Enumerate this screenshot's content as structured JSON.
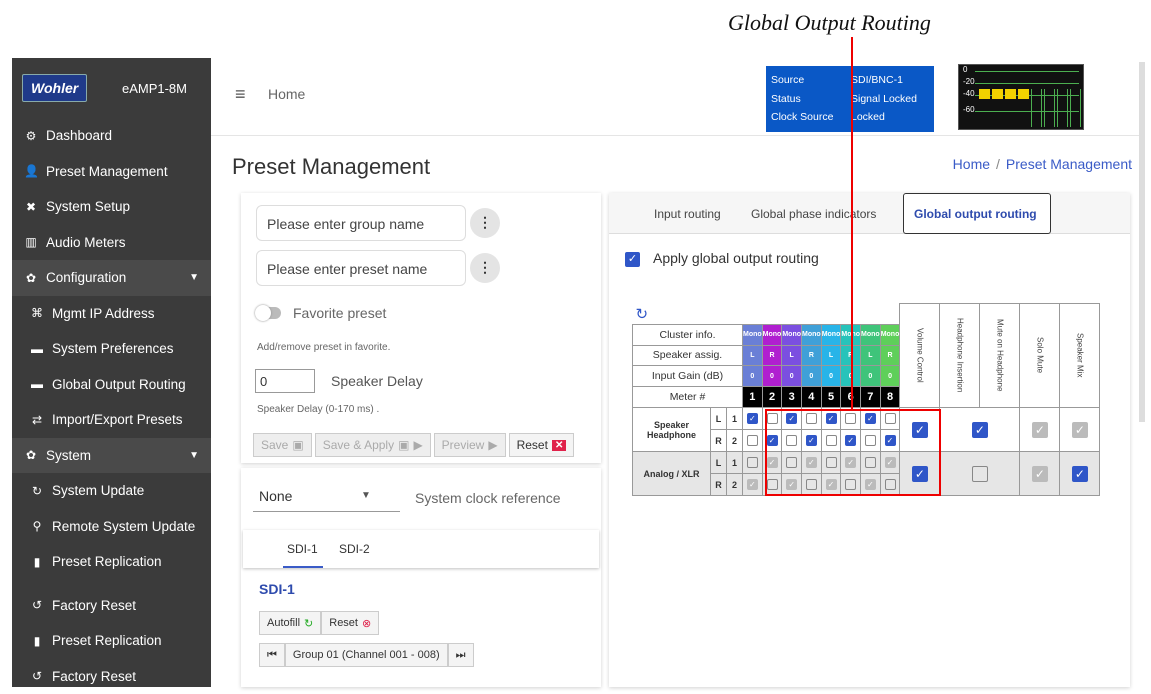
{
  "callout": "Global Output Routing",
  "sidebar": {
    "logo": "Wohler",
    "model": "eAMP1-8M",
    "items": [
      {
        "label": "Dashboard",
        "icon": "dashboard-icon",
        "glyph": "⚙"
      },
      {
        "label": "Preset Management",
        "icon": "user-group-icon",
        "glyph": "👤"
      },
      {
        "label": "System Setup",
        "icon": "tools-icon",
        "glyph": "✖"
      },
      {
        "label": "Audio Meters",
        "icon": "meter-icon",
        "glyph": "▥"
      },
      {
        "label": "Configuration",
        "icon": "cog-icon",
        "glyph": "✿"
      },
      {
        "label": "Mgmt IP Address",
        "icon": "network-icon",
        "glyph": "⌘"
      },
      {
        "label": "System Preferences",
        "icon": "keyboard-icon",
        "glyph": "▬"
      },
      {
        "label": "Global Output Routing",
        "icon": "keyboard-icon",
        "glyph": "▬"
      },
      {
        "label": "Import/Export Presets",
        "icon": "exchange-icon",
        "glyph": "⇄"
      },
      {
        "label": "System",
        "icon": "cogs-icon",
        "glyph": "✿"
      },
      {
        "label": "System Update",
        "icon": "sync-icon",
        "glyph": "↻"
      },
      {
        "label": "Remote System Update",
        "icon": "network-tree-icon",
        "glyph": "⚲"
      },
      {
        "label": "Preset Replication",
        "icon": "copy-icon",
        "glyph": "▮"
      },
      {
        "label": "Factory Reset",
        "icon": "undo-icon",
        "glyph": "↺"
      },
      {
        "label": "Preset Replication",
        "icon": "copy-icon",
        "glyph": "▮"
      },
      {
        "label": "Factory Reset",
        "icon": "undo-icon",
        "glyph": "↺"
      }
    ]
  },
  "topbar": {
    "home": "Home",
    "status": [
      {
        "key": "Source",
        "value": "SDI/BNC-1"
      },
      {
        "key": "Status",
        "value": "Signal Locked"
      },
      {
        "key": "Clock Source",
        "value": "Locked"
      }
    ],
    "meter_labels": [
      "0",
      "-20",
      "-40",
      "-60"
    ]
  },
  "page": {
    "title": "Preset Management",
    "crumb_home": "Home",
    "crumb_sep": "/",
    "crumb_current": "Preset Management"
  },
  "preset": {
    "group_placeholder": "Please enter group name",
    "preset_placeholder": "Please enter preset name",
    "favorite_label": "Favorite preset",
    "favorite_help": "Add/remove preset in favorite.",
    "delay_value": "0",
    "delay_label": "Speaker Delay",
    "delay_help": "Speaker Delay (0-170 ms) .",
    "save": "Save",
    "save_apply": "Save & Apply",
    "preview": "Preview",
    "reset": "Reset"
  },
  "clock": {
    "value": "None",
    "label": "System clock reference",
    "tabs": [
      "SDI-1",
      "SDI-2"
    ],
    "heading": "SDI-1",
    "autofill": "Autofill",
    "reset": "Reset",
    "group": "Group 01 (Channel 001 - 008)"
  },
  "routing": {
    "tabs": [
      "Input routing",
      "Global phase indicators",
      "Global output routing"
    ],
    "apply_label": "Apply global output routing",
    "row_labels": [
      "Cluster info.",
      "Speaker assig.",
      "Input Gain (dB)",
      "Meter #"
    ],
    "cluster": [
      "Mono",
      "Mono",
      "Mono",
      "Mono",
      "Mono",
      "Mono",
      "Mono",
      "Mono"
    ],
    "cluster_colors": [
      "#6a7fd6",
      "#b01fd0",
      "#7b4fe0",
      "#3fa0d8",
      "#28b4e8",
      "#27c3ba",
      "#3fc47a",
      "#5fcf5a"
    ],
    "assign": [
      "L",
      "R",
      "L",
      "R",
      "L",
      "R",
      "L",
      "R"
    ],
    "gain": [
      "0",
      "0",
      "0",
      "0",
      "0",
      "0",
      "0",
      "0"
    ],
    "meters": [
      "1",
      "2",
      "3",
      "4",
      "5",
      "6",
      "7",
      "8"
    ],
    "extra_cols": [
      "Volume Control",
      "Headphone Insertion",
      "Mute on Headphone",
      "Solo Mute",
      "Speaker Mix"
    ],
    "outputs": [
      {
        "name": "Speaker Headphone",
        "ch": [
          [
            "L",
            "1"
          ],
          [
            "R",
            "2"
          ]
        ],
        "row_state": "active"
      },
      {
        "name": "Analog / XLR",
        "ch": [
          [
            "L",
            "1"
          ],
          [
            "R",
            "2"
          ]
        ],
        "row_state": "disabled"
      }
    ]
  }
}
